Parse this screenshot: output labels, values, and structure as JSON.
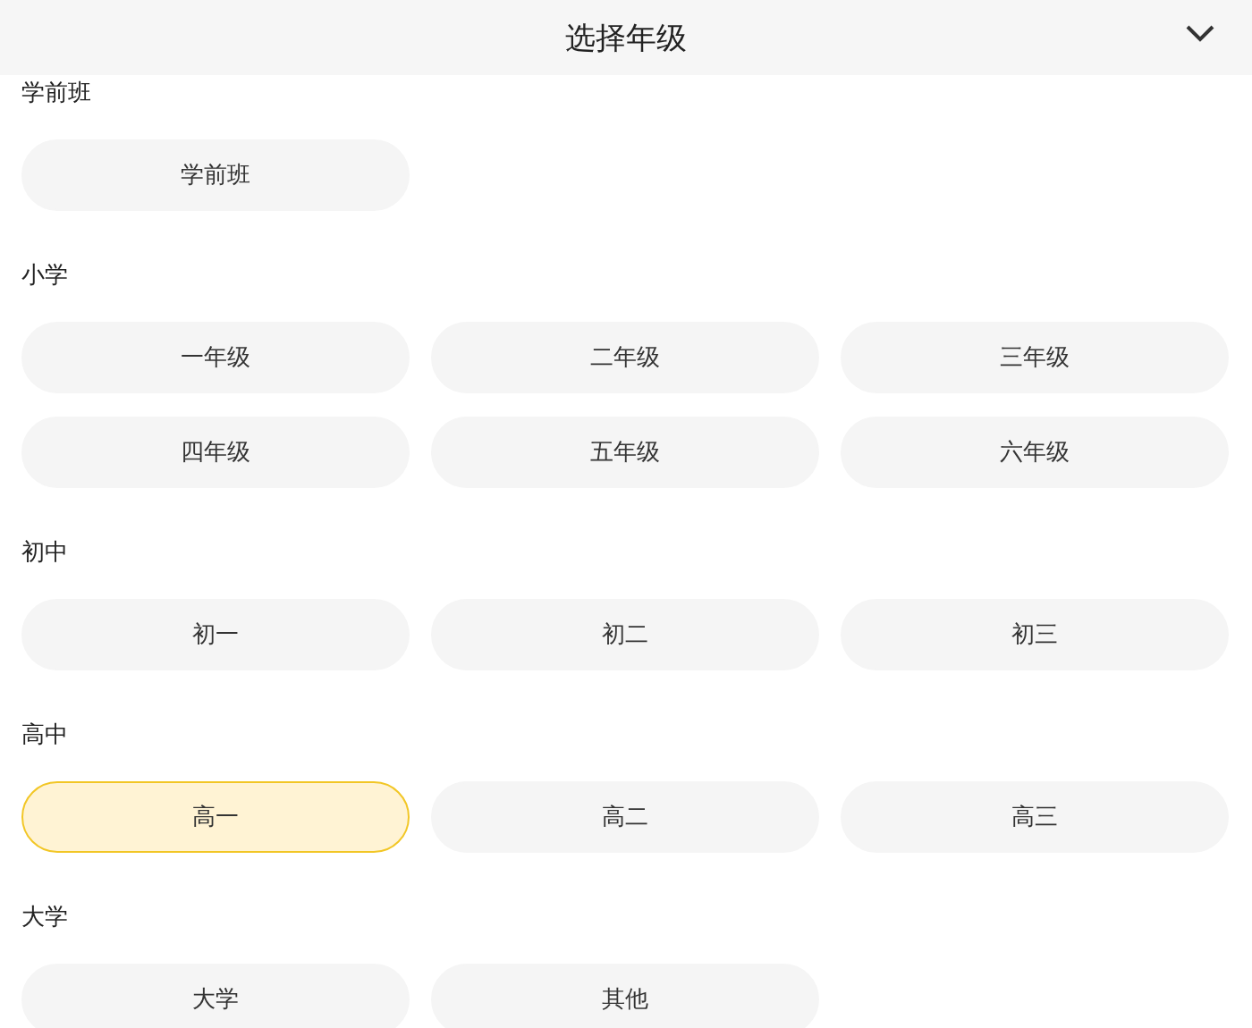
{
  "header": {
    "title": "选择年级"
  },
  "sections": [
    {
      "label": "学前班",
      "options": [
        {
          "label": "学前班",
          "selected": false
        }
      ]
    },
    {
      "label": "小学",
      "options": [
        {
          "label": "一年级",
          "selected": false
        },
        {
          "label": "二年级",
          "selected": false
        },
        {
          "label": "三年级",
          "selected": false
        },
        {
          "label": "四年级",
          "selected": false
        },
        {
          "label": "五年级",
          "selected": false
        },
        {
          "label": "六年级",
          "selected": false
        }
      ]
    },
    {
      "label": "初中",
      "options": [
        {
          "label": "初一",
          "selected": false
        },
        {
          "label": "初二",
          "selected": false
        },
        {
          "label": "初三",
          "selected": false
        }
      ]
    },
    {
      "label": "高中",
      "options": [
        {
          "label": "高一",
          "selected": true
        },
        {
          "label": "高二",
          "selected": false
        },
        {
          "label": "高三",
          "selected": false
        }
      ]
    },
    {
      "label": "大学",
      "options": [
        {
          "label": "大学",
          "selected": false
        },
        {
          "label": "其他",
          "selected": false
        }
      ]
    }
  ]
}
